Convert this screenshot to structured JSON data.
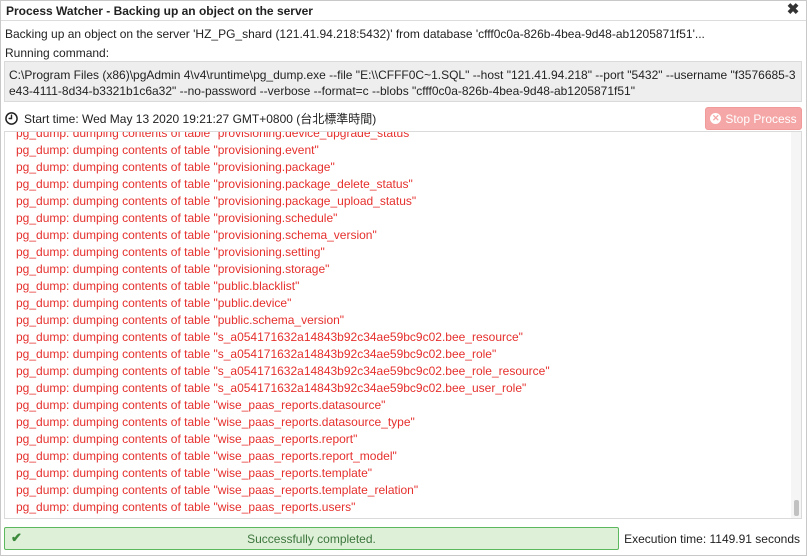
{
  "window": {
    "title": "Process Watcher - Backing up an object on the server",
    "close_glyph": "✖"
  },
  "process": {
    "description": "Backing up an object on the server 'HZ_PG_shard (121.41.94.218:5432)' from database 'cfff0c0a-826b-4bea-9d48-ab1205871f51'...",
    "command_label": "Running command:",
    "command": "C:\\Program Files (x86)\\pgAdmin 4\\v4\\runtime\\pg_dump.exe --file \"E:\\\\CFFF0C~1.SQL\" --host \"121.41.94.218\" --port \"5432\" --username \"f3576685-3e43-4111-8d34-b3321b1c6a32\" --no-password --verbose --format=c --blobs \"cfff0c0a-826b-4bea-9d48-ab1205871f51\"",
    "start_time": "Start time: Wed May 13 2020 19:21:27 GMT+0800 (台北標準時間)",
    "stop_label": "Stop Process"
  },
  "log_lines": [
    "pg_dump: dumping contents of table \"provisioning.device_upgrade_status\"",
    "pg_dump: dumping contents of table \"provisioning.event\"",
    "pg_dump: dumping contents of table \"provisioning.package\"",
    "pg_dump: dumping contents of table \"provisioning.package_delete_status\"",
    "pg_dump: dumping contents of table \"provisioning.package_upload_status\"",
    "pg_dump: dumping contents of table \"provisioning.schedule\"",
    "pg_dump: dumping contents of table \"provisioning.schema_version\"",
    "pg_dump: dumping contents of table \"provisioning.setting\"",
    "pg_dump: dumping contents of table \"provisioning.storage\"",
    "pg_dump: dumping contents of table \"public.blacklist\"",
    "pg_dump: dumping contents of table \"public.device\"",
    "pg_dump: dumping contents of table \"public.schema_version\"",
    "pg_dump: dumping contents of table \"s_a054171632a14843b92c34ae59bc9c02.bee_resource\"",
    "pg_dump: dumping contents of table \"s_a054171632a14843b92c34ae59bc9c02.bee_role\"",
    "pg_dump: dumping contents of table \"s_a054171632a14843b92c34ae59bc9c02.bee_role_resource\"",
    "pg_dump: dumping contents of table \"s_a054171632a14843b92c34ae59bc9c02.bee_user_role\"",
    "pg_dump: dumping contents of table \"wise_paas_reports.datasource\"",
    "pg_dump: dumping contents of table \"wise_paas_reports.datasource_type\"",
    "pg_dump: dumping contents of table \"wise_paas_reports.report\"",
    "pg_dump: dumping contents of table \"wise_paas_reports.report_model\"",
    "pg_dump: dumping contents of table \"wise_paas_reports.template\"",
    "pg_dump: dumping contents of table \"wise_paas_reports.template_relation\"",
    "pg_dump: dumping contents of table \"wise_paas_reports.users\""
  ],
  "status": {
    "message": "Successfully completed.",
    "execution_time": "Execution time: 1149.91 seconds",
    "check_glyph": "✔"
  },
  "colors": {
    "log_text": "#e5302d",
    "stop_button": "#f5a6a6",
    "success_bg": "#dff0d8",
    "success_border": "#5cb85c"
  },
  "icons": {
    "clock": "clock-icon",
    "close": "close-icon",
    "stop": "stop-circle-icon",
    "check": "check-icon"
  }
}
